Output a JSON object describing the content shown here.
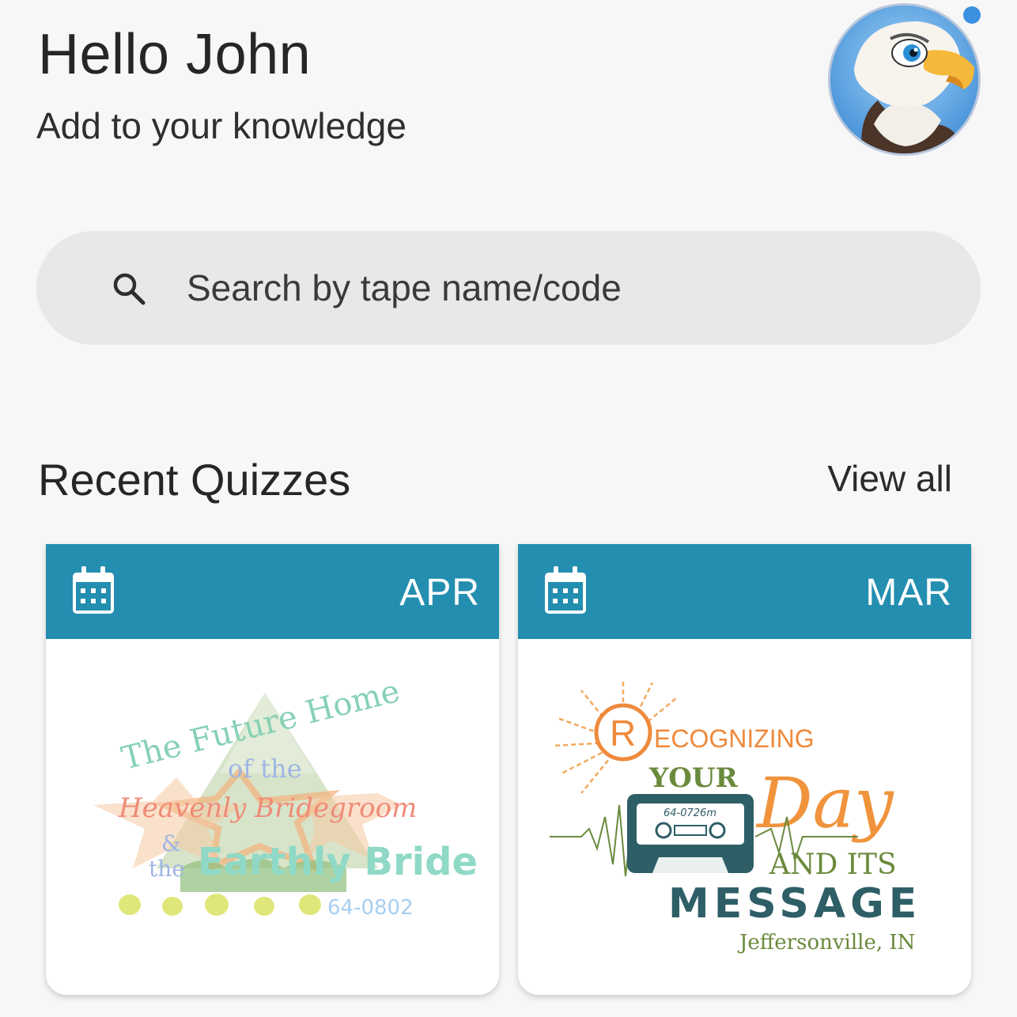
{
  "greeting": {
    "title": "Hello John",
    "subtitle": "Add to your knowledge"
  },
  "search": {
    "placeholder": "Search by tape name/code",
    "icon": "search-icon"
  },
  "recent": {
    "title": "Recent Quizzes",
    "view_all": "View all",
    "cards": [
      {
        "month": "APR",
        "icon": "calendar-icon",
        "art": {
          "line1": "The Future Home",
          "line2": "of the",
          "line3": "Heavenly Bridegroom",
          "line4a": "&",
          "line4b": "the",
          "line5": "Earthly Bride",
          "code": "64-0802"
        }
      },
      {
        "month": "MAR",
        "icon": "calendar-icon",
        "art": {
          "r": "R",
          "line1": "ECOGNIZING",
          "line2": "YOUR",
          "line3": "Day",
          "line4": "AND ITS",
          "line5": "MESSAGE",
          "place": "Jeffersonville, IN",
          "code": "64-0726m"
        }
      }
    ]
  },
  "colors": {
    "accent": "#238eb0",
    "background": "#f7f7f8",
    "search_bg": "#e7e8ea",
    "notification_dot": "#3d8fe0"
  }
}
